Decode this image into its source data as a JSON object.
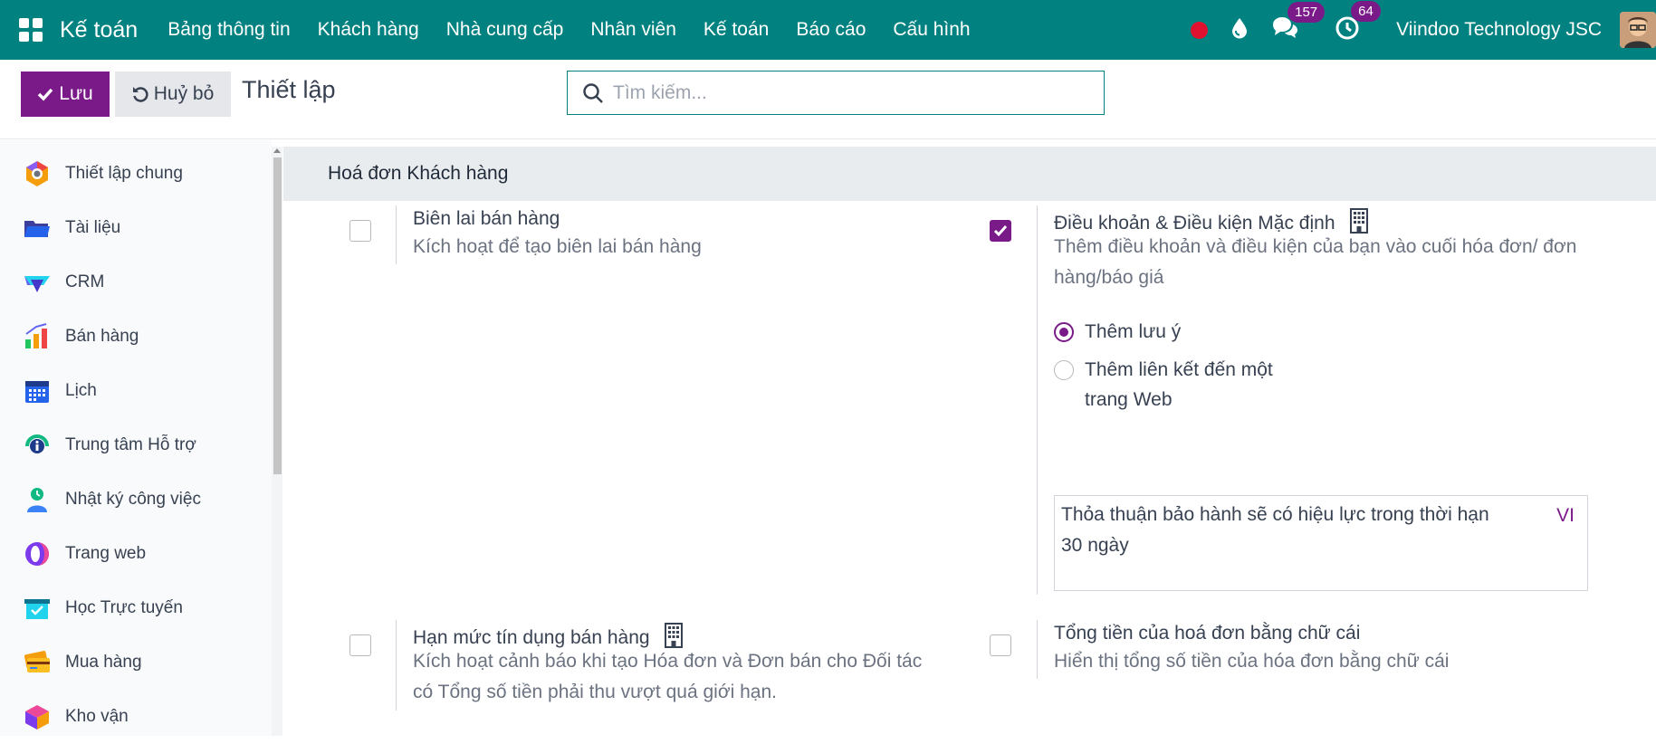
{
  "navbar": {
    "brand": "Kế toán",
    "menu": [
      "Bảng thông tin",
      "Khách hàng",
      "Nhà cung cấp",
      "Nhân viên",
      "Kế toán",
      "Báo cáo",
      "Cấu hình"
    ],
    "messages_count": "157",
    "activities_count": "64",
    "company": "Viindoo Technology JSC"
  },
  "control": {
    "save_label": "Lưu",
    "discard_label": "Huỷ bỏ",
    "title": "Thiết lập",
    "search_placeholder": "Tìm kiếm..."
  },
  "sidebar": {
    "items": [
      {
        "label": "Thiết lập chung",
        "icon": "settings-hexagon-icon"
      },
      {
        "label": "Tài liệu",
        "icon": "folder-icon"
      },
      {
        "label": "CRM",
        "icon": "crm-icon"
      },
      {
        "label": "Bán hàng",
        "icon": "sales-chart-icon"
      },
      {
        "label": "Lịch",
        "icon": "calendar-icon"
      },
      {
        "label": "Trung tâm Hỗ trợ",
        "icon": "helpdesk-icon"
      },
      {
        "label": "Nhật ký công việc",
        "icon": "timesheet-icon"
      },
      {
        "label": "Trang web",
        "icon": "website-icon"
      },
      {
        "label": "Học Trực tuyến",
        "icon": "elearning-icon"
      },
      {
        "label": "Mua hàng",
        "icon": "purchase-card-icon"
      },
      {
        "label": "Kho vận",
        "icon": "inventory-box-icon"
      }
    ]
  },
  "section": {
    "title": "Hoá đơn Khách hàng",
    "sales_receipts": {
      "title": "Biên lai bán hàng",
      "desc": "Kích hoạt để tạo biên lai bán hàng",
      "checked": false
    },
    "default_terms": {
      "title": "Điều khoản & Điều kiện Mặc định",
      "desc": "Thêm điều khoản và điều kiện của bạn vào cuối hóa đơn/ đơn hàng/báo giá",
      "checked": true,
      "option_note": "Thêm lưu ý",
      "option_link": "Thêm liên kết đến một trang Web",
      "terms_text": "Thỏa thuận bảo hành sẽ có hiệu lực trong thời hạn 30 ngày",
      "lang": "VI"
    },
    "credit_limit": {
      "title": "Hạn mức tín dụng bán hàng",
      "desc": "Kích hoạt cảnh báo khi tạo Hóa đơn và Đơn bán cho Đối tác có Tổng số tiền phải thu vượt quá giới hạn.",
      "checked": false
    },
    "amount_in_words": {
      "title": "Tổng tiền của hoá đơn bằng chữ cái",
      "desc": "Hiển thị tổng số tiền của hóa đơn bằng chữ cái",
      "checked": false
    }
  },
  "colors": {
    "navbar": "#018281",
    "accent": "#7a1a88"
  }
}
